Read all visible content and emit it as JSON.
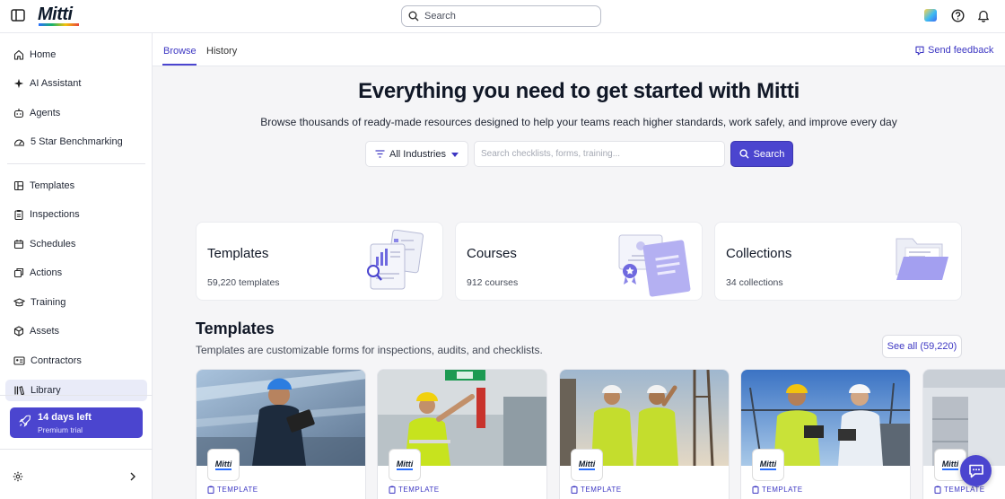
{
  "app": {
    "logo": "Mitti"
  },
  "topbar": {
    "search_placeholder": "Search"
  },
  "sidebar": {
    "items": [
      {
        "label": "Home",
        "icon": "home-icon"
      },
      {
        "label": "AI Assistant",
        "icon": "sparkle-icon"
      },
      {
        "label": "Agents",
        "icon": "robot-icon"
      },
      {
        "label": "5 Star Benchmarking",
        "icon": "gauge-icon"
      },
      {
        "label": "Templates",
        "icon": "template-icon"
      },
      {
        "label": "Inspections",
        "icon": "clipboard-icon"
      },
      {
        "label": "Schedules",
        "icon": "calendar-icon"
      },
      {
        "label": "Actions",
        "icon": "actions-icon"
      },
      {
        "label": "Training",
        "icon": "graduation-cap-icon"
      },
      {
        "label": "Assets",
        "icon": "cube-icon"
      },
      {
        "label": "Contractors",
        "icon": "id-card-icon"
      },
      {
        "label": "Library",
        "icon": "library-icon",
        "active": true
      }
    ],
    "trial": {
      "title": "14 days left",
      "subtitle": "Premium trial"
    }
  },
  "tabs": [
    {
      "label": "Browse",
      "active": true
    },
    {
      "label": "History",
      "active": false
    }
  ],
  "feedback_label": "Send feedback",
  "hero": {
    "title": "Everything you need to get started with Mitti",
    "subtitle": "Browse thousands of ready-made resources designed to help your teams reach higher standards, work safely, and improve every day",
    "industry_filter": "All Industries",
    "search_placeholder": "Search checklists, forms, training...",
    "search_button": "Search"
  },
  "categories": [
    {
      "title": "Templates",
      "count": "59,220 templates"
    },
    {
      "title": "Courses",
      "count": "912 courses"
    },
    {
      "title": "Collections",
      "count": "34 collections"
    }
  ],
  "templates_section": {
    "title": "Templates",
    "subtitle": "Templates are customizable forms for inspections, audits, and checklists.",
    "see_all": "See all (59,220)",
    "cards": [
      {
        "badge": "Mitti",
        "type": "TEMPLATE"
      },
      {
        "badge": "Mitti",
        "type": "TEMPLATE"
      },
      {
        "badge": "Mitti",
        "type": "TEMPLATE"
      },
      {
        "badge": "Mitti",
        "type": "TEMPLATE"
      },
      {
        "badge": "Mitti",
        "type": "TEMPLATE"
      }
    ]
  },
  "colors": {
    "accent": "#4b45cf",
    "accent_text": "#3d37c3",
    "main_bg": "#f5f5f7"
  }
}
